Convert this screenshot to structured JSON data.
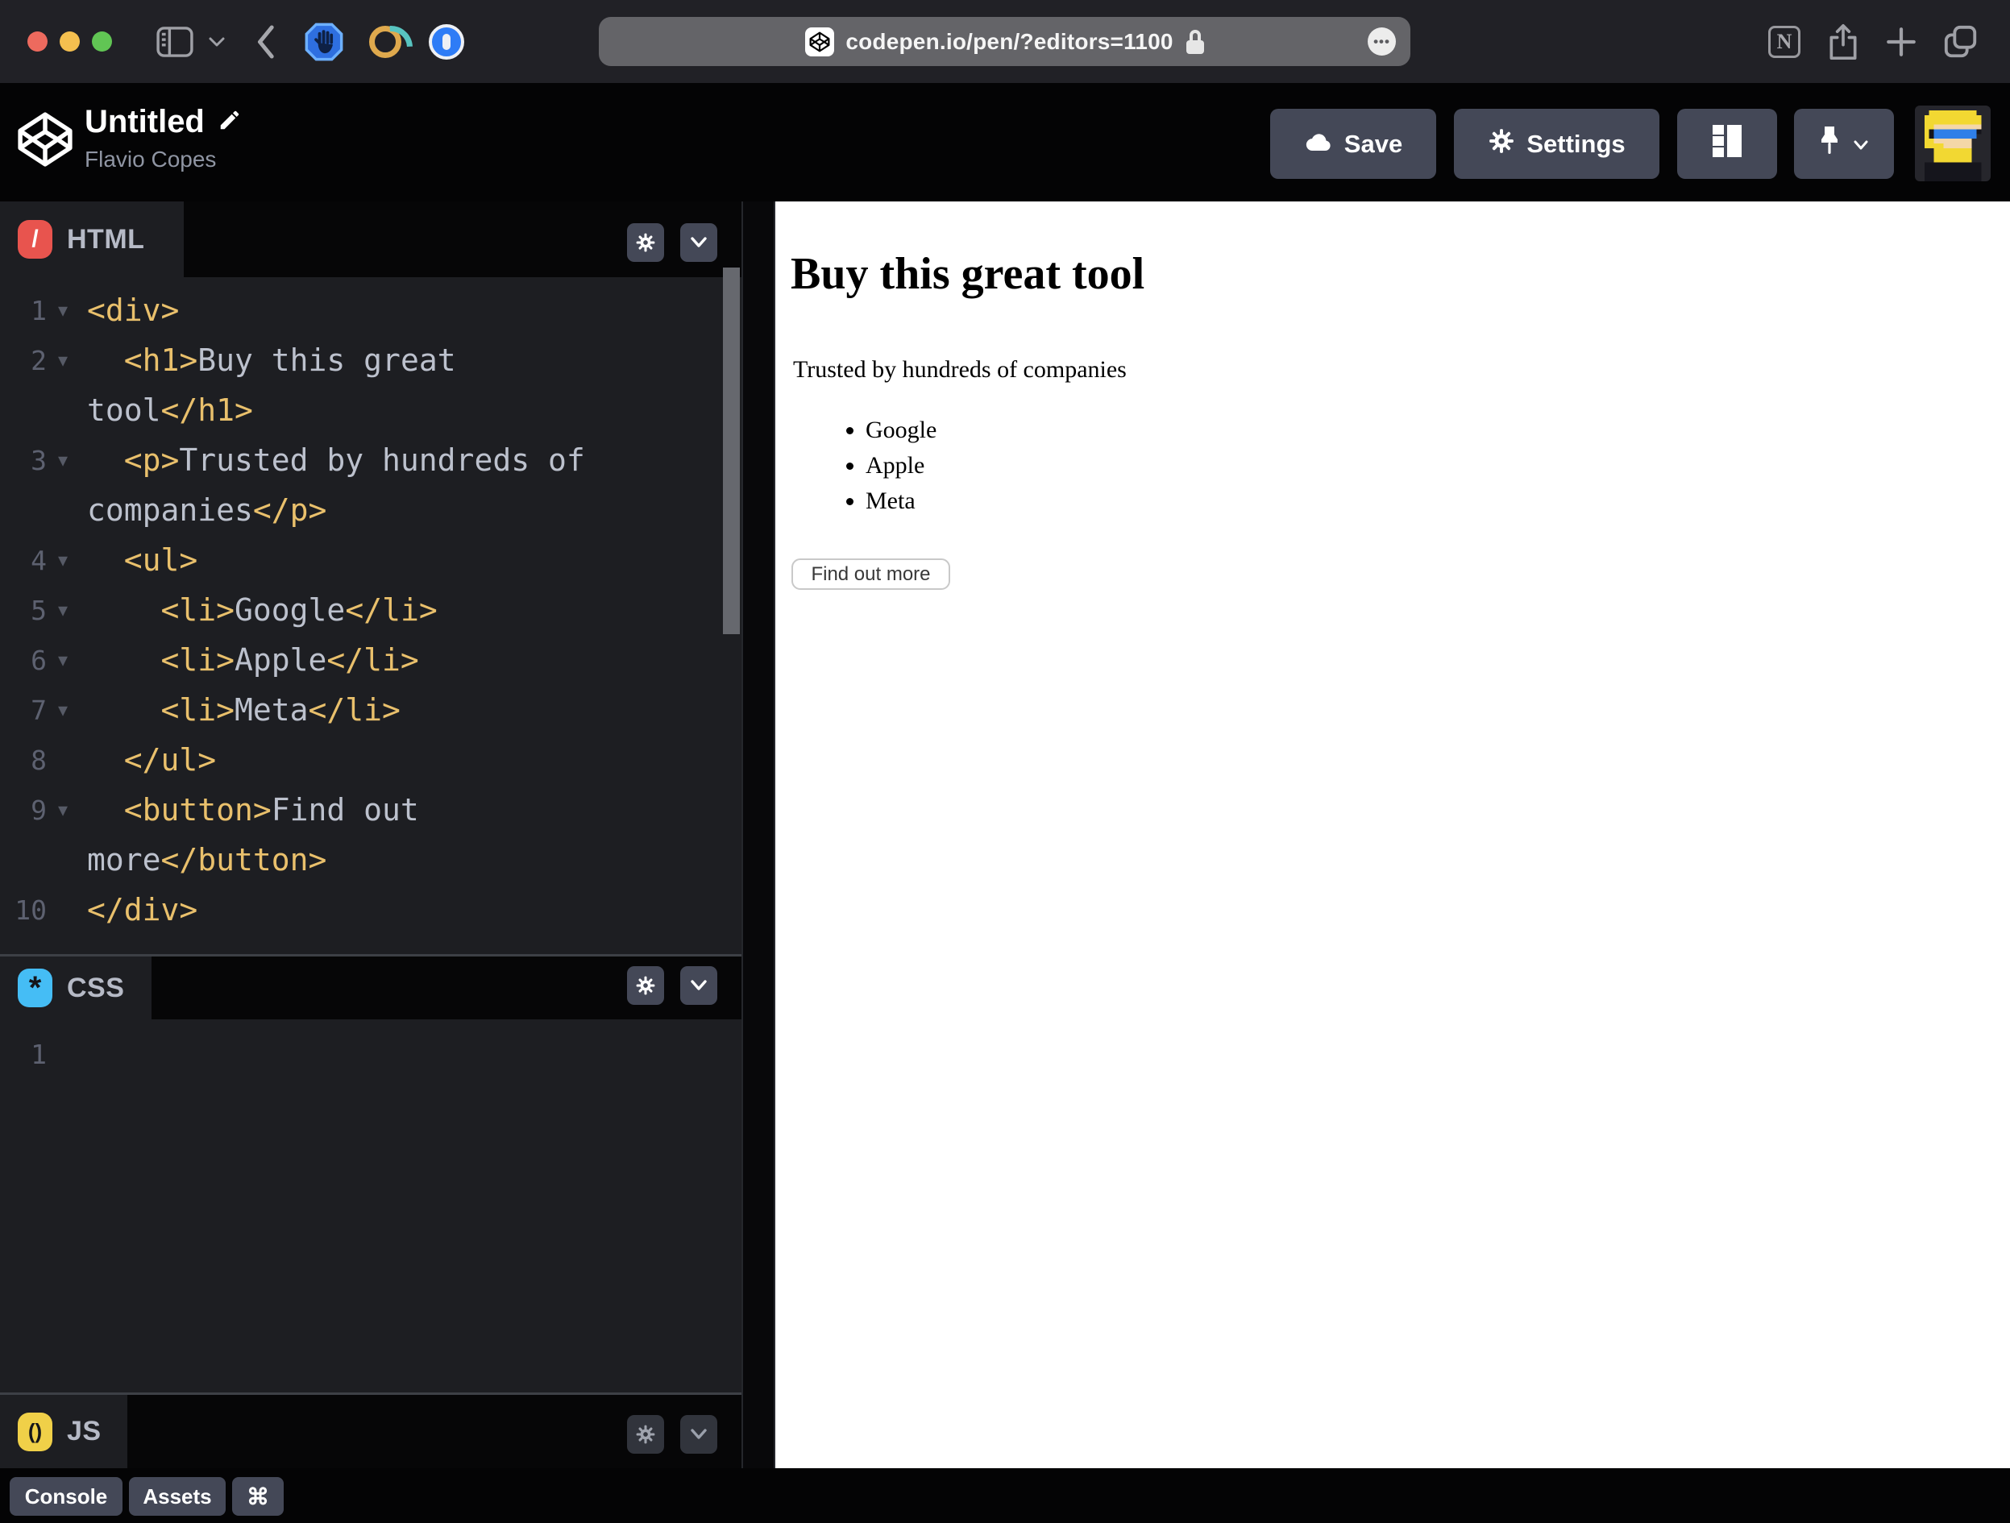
{
  "browser": {
    "url": "codepen.io/pen/?editors=1100",
    "more_dots": "•••",
    "notion_letter": "N"
  },
  "header": {
    "title": "Untitled",
    "author": "Flavio Copes",
    "save_label": "Save",
    "settings_label": "Settings"
  },
  "editors": {
    "html": {
      "label": "HTML",
      "badge_glyph": "/",
      "rows": [
        {
          "num": "1",
          "fold": true,
          "segs": [
            {
              "c": "tg",
              "v": "<div>"
            }
          ]
        },
        {
          "num": "2",
          "fold": true,
          "segs": [
            {
              "c": "tg",
              "v": "  <h1>"
            },
            {
              "c": "tx",
              "v": "Buy this great"
            }
          ]
        },
        {
          "num": "",
          "fold": false,
          "segs": [
            {
              "c": "tx",
              "v": "tool"
            },
            {
              "c": "tg",
              "v": "</h1>"
            }
          ]
        },
        {
          "num": "3",
          "fold": true,
          "segs": [
            {
              "c": "tg",
              "v": "  <p>"
            },
            {
              "c": "tx",
              "v": "Trusted by hundreds of"
            }
          ]
        },
        {
          "num": "",
          "fold": false,
          "segs": [
            {
              "c": "tx",
              "v": "companies"
            },
            {
              "c": "tg",
              "v": "</p>"
            }
          ]
        },
        {
          "num": "4",
          "fold": true,
          "segs": [
            {
              "c": "tg",
              "v": "  <ul>"
            }
          ]
        },
        {
          "num": "5",
          "fold": true,
          "segs": [
            {
              "c": "tg",
              "v": "    <li>"
            },
            {
              "c": "tx",
              "v": "Google"
            },
            {
              "c": "tg",
              "v": "</li>"
            }
          ]
        },
        {
          "num": "6",
          "fold": true,
          "segs": [
            {
              "c": "tg",
              "v": "    <li>"
            },
            {
              "c": "tx",
              "v": "Apple"
            },
            {
              "c": "tg",
              "v": "</li>"
            }
          ]
        },
        {
          "num": "7",
          "fold": true,
          "segs": [
            {
              "c": "tg",
              "v": "    <li>"
            },
            {
              "c": "tx",
              "v": "Meta"
            },
            {
              "c": "tg",
              "v": "</li>"
            }
          ]
        },
        {
          "num": "8",
          "fold": false,
          "segs": [
            {
              "c": "tg",
              "v": "  </ul>"
            }
          ]
        },
        {
          "num": "9",
          "fold": true,
          "segs": [
            {
              "c": "tg",
              "v": "  <button>"
            },
            {
              "c": "tx",
              "v": "Find out"
            }
          ]
        },
        {
          "num": "",
          "fold": false,
          "segs": [
            {
              "c": "tx",
              "v": "more"
            },
            {
              "c": "tg",
              "v": "</button>"
            }
          ]
        },
        {
          "num": "10",
          "fold": false,
          "segs": [
            {
              "c": "tg",
              "v": "</div>"
            }
          ]
        }
      ],
      "fold_glyph": "▾"
    },
    "css": {
      "label": "CSS",
      "badge_glyph": "*",
      "rows": [
        {
          "num": "1",
          "fold": false,
          "segs": []
        }
      ],
      "fold_glyph": "▾"
    },
    "js": {
      "label": "JS",
      "badge_glyph": "()"
    }
  },
  "preview": {
    "heading": "Buy this great tool",
    "paragraph": "Trusted by hundreds of companies",
    "list": [
      "Google",
      "Apple",
      "Meta"
    ],
    "button_label": "Find out more"
  },
  "footer": {
    "console_label": "Console",
    "assets_label": "Assets",
    "cmd_glyph": "⌘"
  },
  "colors": {
    "html_badge": "#e8544e",
    "css_badge": "#45bdf5",
    "js_badge": "#f0d048",
    "tag": "#e9c06c",
    "code_text": "#bcc1cd",
    "editor_bg": "#1d1e22",
    "button_gray": "#444857"
  }
}
